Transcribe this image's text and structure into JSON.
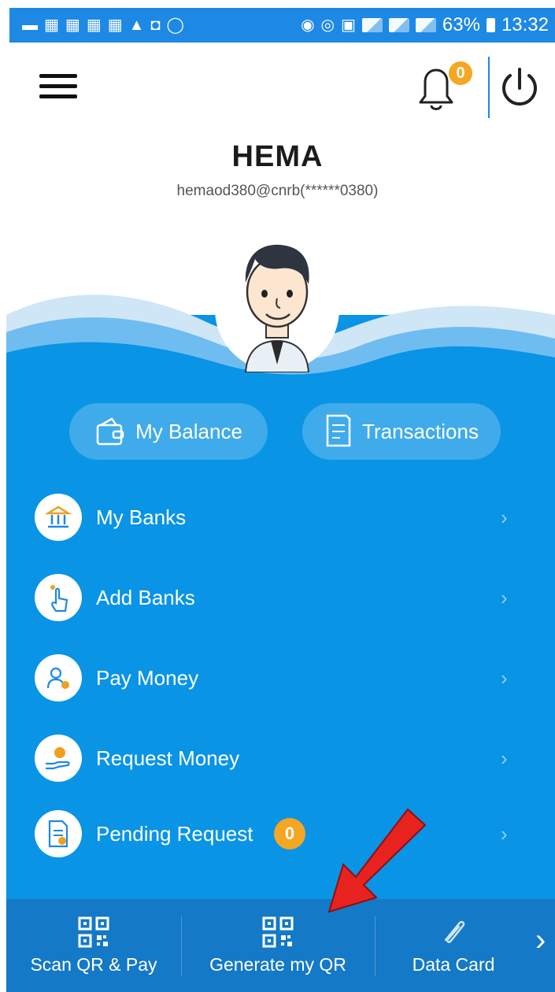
{
  "status_bar": {
    "battery_percent": "63%",
    "time": "13:32",
    "icons": [
      "message-icon",
      "sim-icon",
      "sim-icon",
      "sim-icon",
      "sim-icon",
      "notification-bell-icon",
      "hangouts-icon",
      "whatsapp-icon",
      "location-icon",
      "alarm-icon",
      "data-saver-icon",
      "signal-icon",
      "signal-icon",
      "signal-icon",
      "battery-icon"
    ]
  },
  "header": {
    "notification_count": "0",
    "icons": [
      "menu-icon",
      "bell-icon",
      "power-icon"
    ]
  },
  "profile": {
    "name": "HEMA",
    "upi_id": "hemaod380@cnrb(******0380)"
  },
  "quick_actions": [
    {
      "label": "My Balance",
      "icon": "wallet-icon"
    },
    {
      "label": "Transactions",
      "icon": "receipt-icon"
    }
  ],
  "menu": [
    {
      "label": "My Banks",
      "icon": "bank-icon"
    },
    {
      "label": "Add Banks",
      "icon": "add-bank-icon"
    },
    {
      "label": "Pay Money",
      "icon": "pay-money-icon"
    },
    {
      "label": "Request Money",
      "icon": "request-money-icon"
    },
    {
      "label": "Pending Request",
      "icon": "pending-request-icon",
      "badge": "0"
    }
  ],
  "bottom_nav": [
    {
      "label": "Scan QR & Pay",
      "icon": "qr-code-icon"
    },
    {
      "label": "Generate my QR",
      "icon": "qr-code-icon"
    },
    {
      "label": "Data Card",
      "icon": "data-card-icon"
    }
  ],
  "colors": {
    "status_bar": "#1e88e5",
    "panel": "#0994e6",
    "bottom_nav": "#1479c6",
    "badge": "#f5a623",
    "annotation_arrow": "#e8231f"
  }
}
